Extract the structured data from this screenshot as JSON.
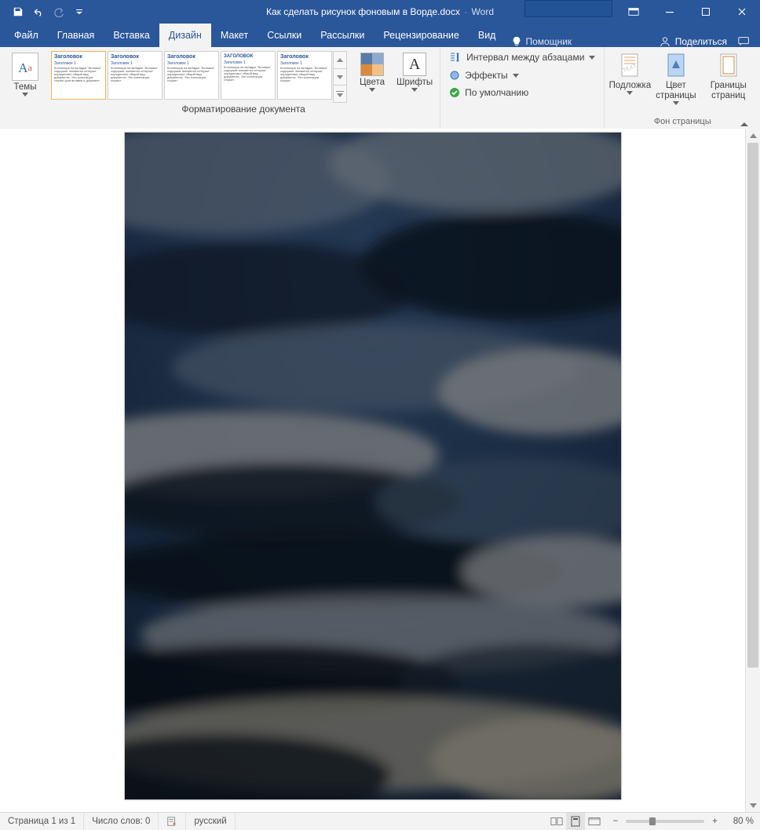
{
  "title": {
    "doc": "Как сделать рисунок фоновым в Ворде.docx",
    "sep": "-",
    "app": "Word"
  },
  "tabs": {
    "file": "Файл",
    "home": "Главная",
    "insert": "Вставка",
    "design": "Дизайн",
    "layout": "Макет",
    "references": "Ссылки",
    "mailings": "Рассылки",
    "review": "Рецензирование",
    "view": "Вид",
    "tell_me": "Помощник",
    "share": "Поделиться"
  },
  "ribbon": {
    "themes": "Темы",
    "colors": "Цвета",
    "fonts": "Шрифты",
    "doc_formatting": "Форматирование документа",
    "paragraph_spacing": "Интервал между абзацами",
    "effects": "Эффекты",
    "set_default": "По умолчанию",
    "watermark": "Подложка",
    "page_color": "Цвет страницы",
    "page_borders": "Границы страниц",
    "page_background": "Фон страницы",
    "gallery_heading": "Заголовок",
    "gallery_sub": "Заголовок 1"
  },
  "status": {
    "page": "Страница 1 из 1",
    "words": "Число слов: 0",
    "lang": "русский",
    "zoom": "80 %"
  }
}
